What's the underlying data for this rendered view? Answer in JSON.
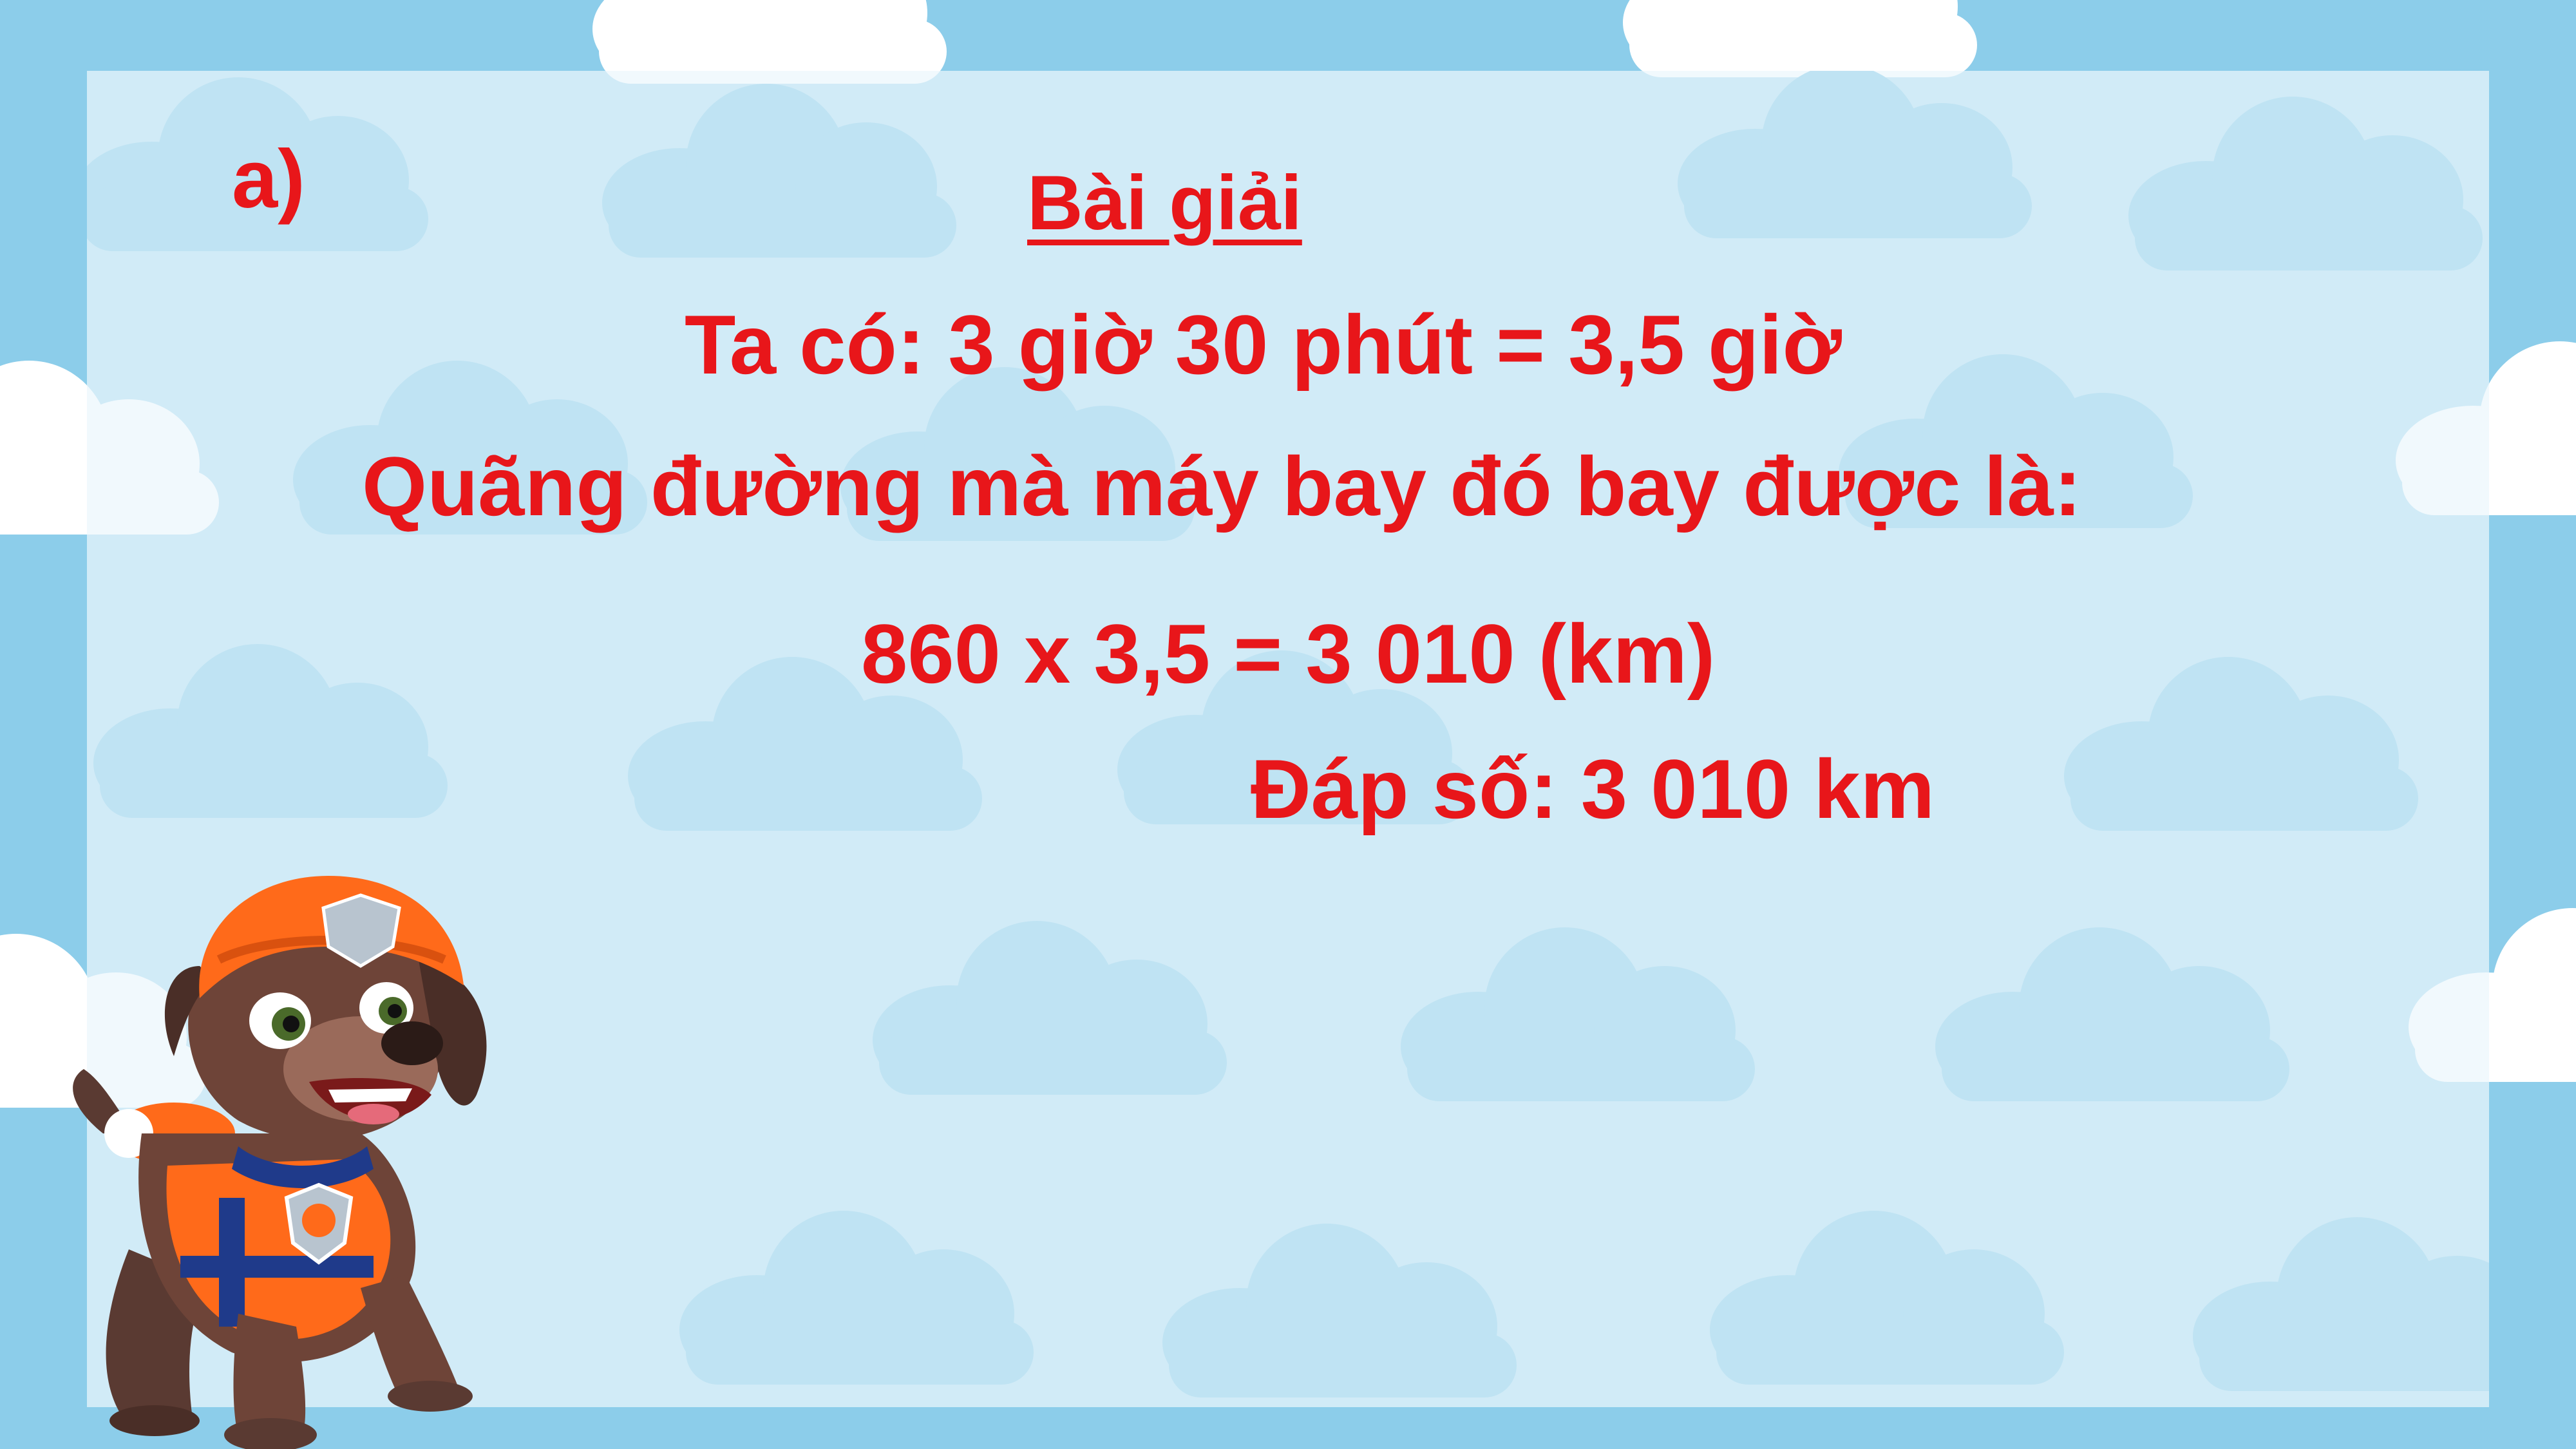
{
  "slide": {
    "part_label": "a)",
    "heading": "Bài giải",
    "line1": "Ta có: 3 giờ 30 phút = 3,5 giờ",
    "line2": "Quãng đường mà máy bay đó bay được là:",
    "line3": "860 x 3,5 = 3 010 (km)",
    "answer": "Đáp số: 3 010 km"
  },
  "colors": {
    "text": "#e8161a",
    "sky": "#8ccdea",
    "panel": "#ecf7fc"
  },
  "decoration": {
    "character": "cartoon-dog-icon",
    "background": "cloud-icon"
  }
}
